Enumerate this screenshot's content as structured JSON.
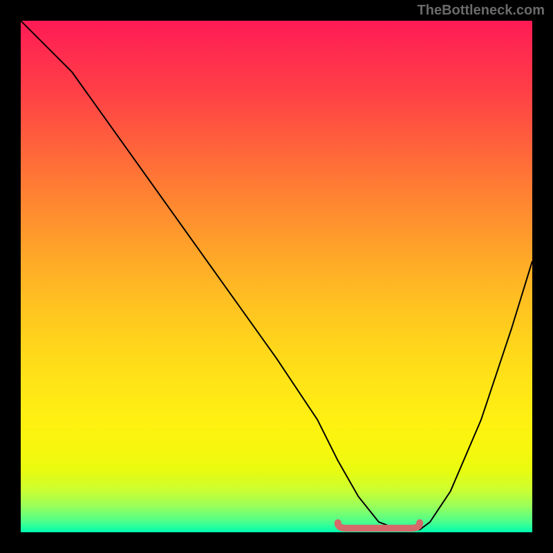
{
  "watermark": "TheBottleneck.com",
  "chart_data": {
    "type": "line",
    "title": "",
    "xlabel": "",
    "ylabel": "",
    "xlim": [
      0,
      100
    ],
    "ylim": [
      0,
      100
    ],
    "series": [
      {
        "name": "bottleneck-curve",
        "x": [
          0,
          4,
          10,
          20,
          30,
          40,
          50,
          58,
          62,
          66,
          70,
          74,
          78,
          80,
          84,
          90,
          96,
          100
        ],
        "values": [
          100,
          96,
          90,
          76,
          62,
          48,
          34,
          22,
          14,
          7,
          2,
          0.5,
          0.5,
          2,
          8,
          22,
          40,
          53
        ]
      }
    ],
    "flat_segment": {
      "name": "valley-highlight",
      "x_start": 62,
      "x_end": 78,
      "y": 0.8,
      "color": "#d46a6a"
    },
    "gradient_stops": [
      {
        "pos": 0,
        "color": "#ff1a55"
      },
      {
        "pos": 50,
        "color": "#ffbe22"
      },
      {
        "pos": 85,
        "color": "#f6f70d"
      },
      {
        "pos": 100,
        "color": "#00ffb0"
      }
    ]
  }
}
